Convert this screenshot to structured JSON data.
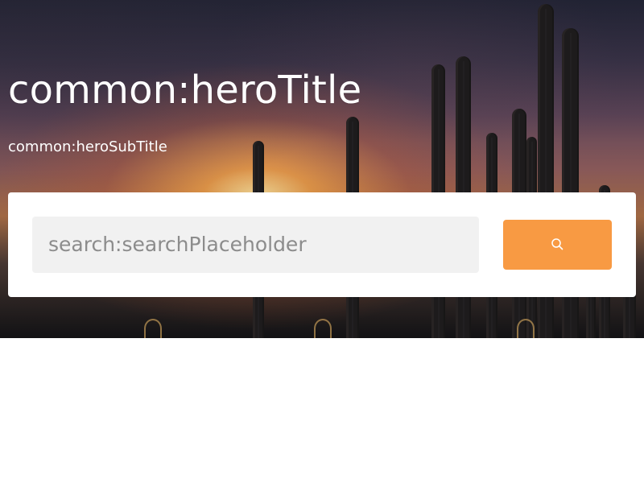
{
  "hero": {
    "title": "common:heroTitle",
    "subtitle": "common:heroSubTitle"
  },
  "search": {
    "placeholder": "search:searchPlaceholder",
    "button_icon": "search-icon"
  },
  "colors": {
    "accent": "#f89a43",
    "card": "#ffffff",
    "input_background": "#f1f1f1",
    "hero_text": "#ffffff"
  }
}
